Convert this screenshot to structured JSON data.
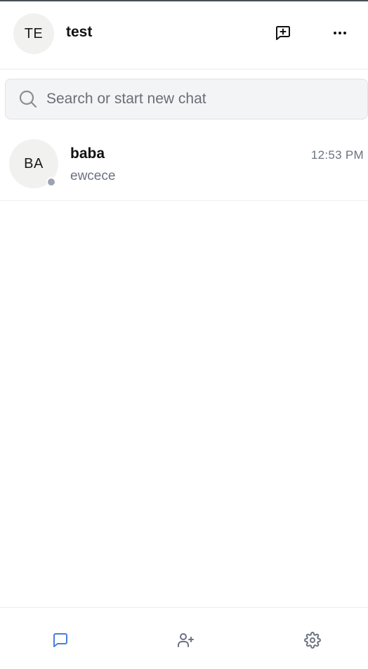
{
  "header": {
    "avatar_initials": "TE",
    "user_name": "test",
    "new_chat_icon": "message-plus-icon",
    "more_icon": "more-horizontal-icon"
  },
  "search": {
    "placeholder": "Search or start new chat",
    "value": "",
    "icon": "search-icon"
  },
  "chats": [
    {
      "avatar_initials": "BA",
      "name": "baba",
      "time": "12:53 PM",
      "preview": "ewcece",
      "status": "offline"
    }
  ],
  "bottom_nav": {
    "items": [
      {
        "icon": "chat-icon",
        "active": true
      },
      {
        "icon": "user-plus-icon",
        "active": false
      },
      {
        "icon": "settings-icon",
        "active": false
      }
    ]
  },
  "colors": {
    "accent": "#4a7fd6",
    "icon_gray": "#6b7280",
    "status_offline": "#9ca3b4",
    "avatar_bg": "#f1f1f0"
  }
}
